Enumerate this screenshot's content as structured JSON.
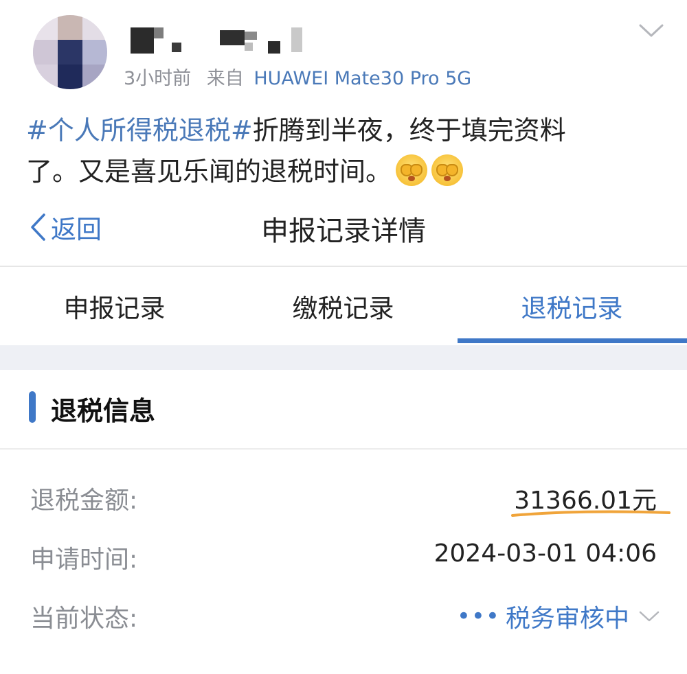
{
  "post": {
    "meta_time": "3小时前",
    "meta_from": "来自",
    "meta_device": "HUAWEI Mate30 Pro 5G",
    "hashtag": "#个人所得税退税#",
    "body_line1": "折腾到半夜，终于填完资料",
    "body_line2": "了。又是喜见乐闻的退税时间。",
    "emojis": [
      "face-emoji",
      "face-emoji"
    ]
  },
  "app": {
    "back_label": "返回",
    "title": "申报记录详情",
    "tabs": [
      {
        "label": "申报记录",
        "active": false
      },
      {
        "label": "缴税记录",
        "active": false
      },
      {
        "label": "退税记录",
        "active": true
      }
    ],
    "section_title": "退税信息",
    "rows": [
      {
        "label": "退税金额:",
        "value": "31366.01元"
      },
      {
        "label": "申请时间:",
        "value": "2024-03-01 04:06"
      },
      {
        "label": "当前状态:",
        "value": "税务审核中"
      }
    ],
    "status_prefix": "•••"
  },
  "colors": {
    "accent": "#3f78c7",
    "link": "#4a79b8",
    "highlight": "#f0a43a"
  }
}
